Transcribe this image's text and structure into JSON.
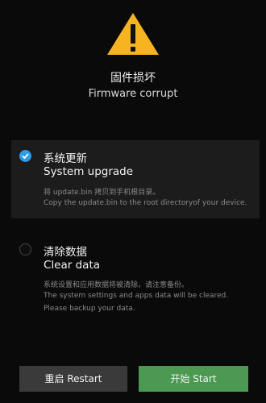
{
  "header": {
    "title_cn": "固件损坏",
    "title_en": "Firmware corrupt",
    "icon": "warning-icon",
    "icon_color": "#f6b421"
  },
  "options": [
    {
      "selected": true,
      "label_cn": "系统更新",
      "label_en": "System upgrade",
      "desc": [
        "将 update.bin 拷贝到手机根目录。",
        "Copy the update.bin to the root directoryof your device."
      ]
    },
    {
      "selected": false,
      "label_cn": "清除数据",
      "label_en": "Clear data",
      "desc": [
        "系统设置和应用数据将被清除，请注意备份。",
        "The system settings and apps data will be cleared.",
        "Please backup your data."
      ]
    }
  ],
  "buttons": {
    "restart": "重启 Restart",
    "start": "开始 Start"
  },
  "colors": {
    "accent": "#2f9be6",
    "start_button": "#4c9a52",
    "restart_button": "#3a3a3a"
  }
}
